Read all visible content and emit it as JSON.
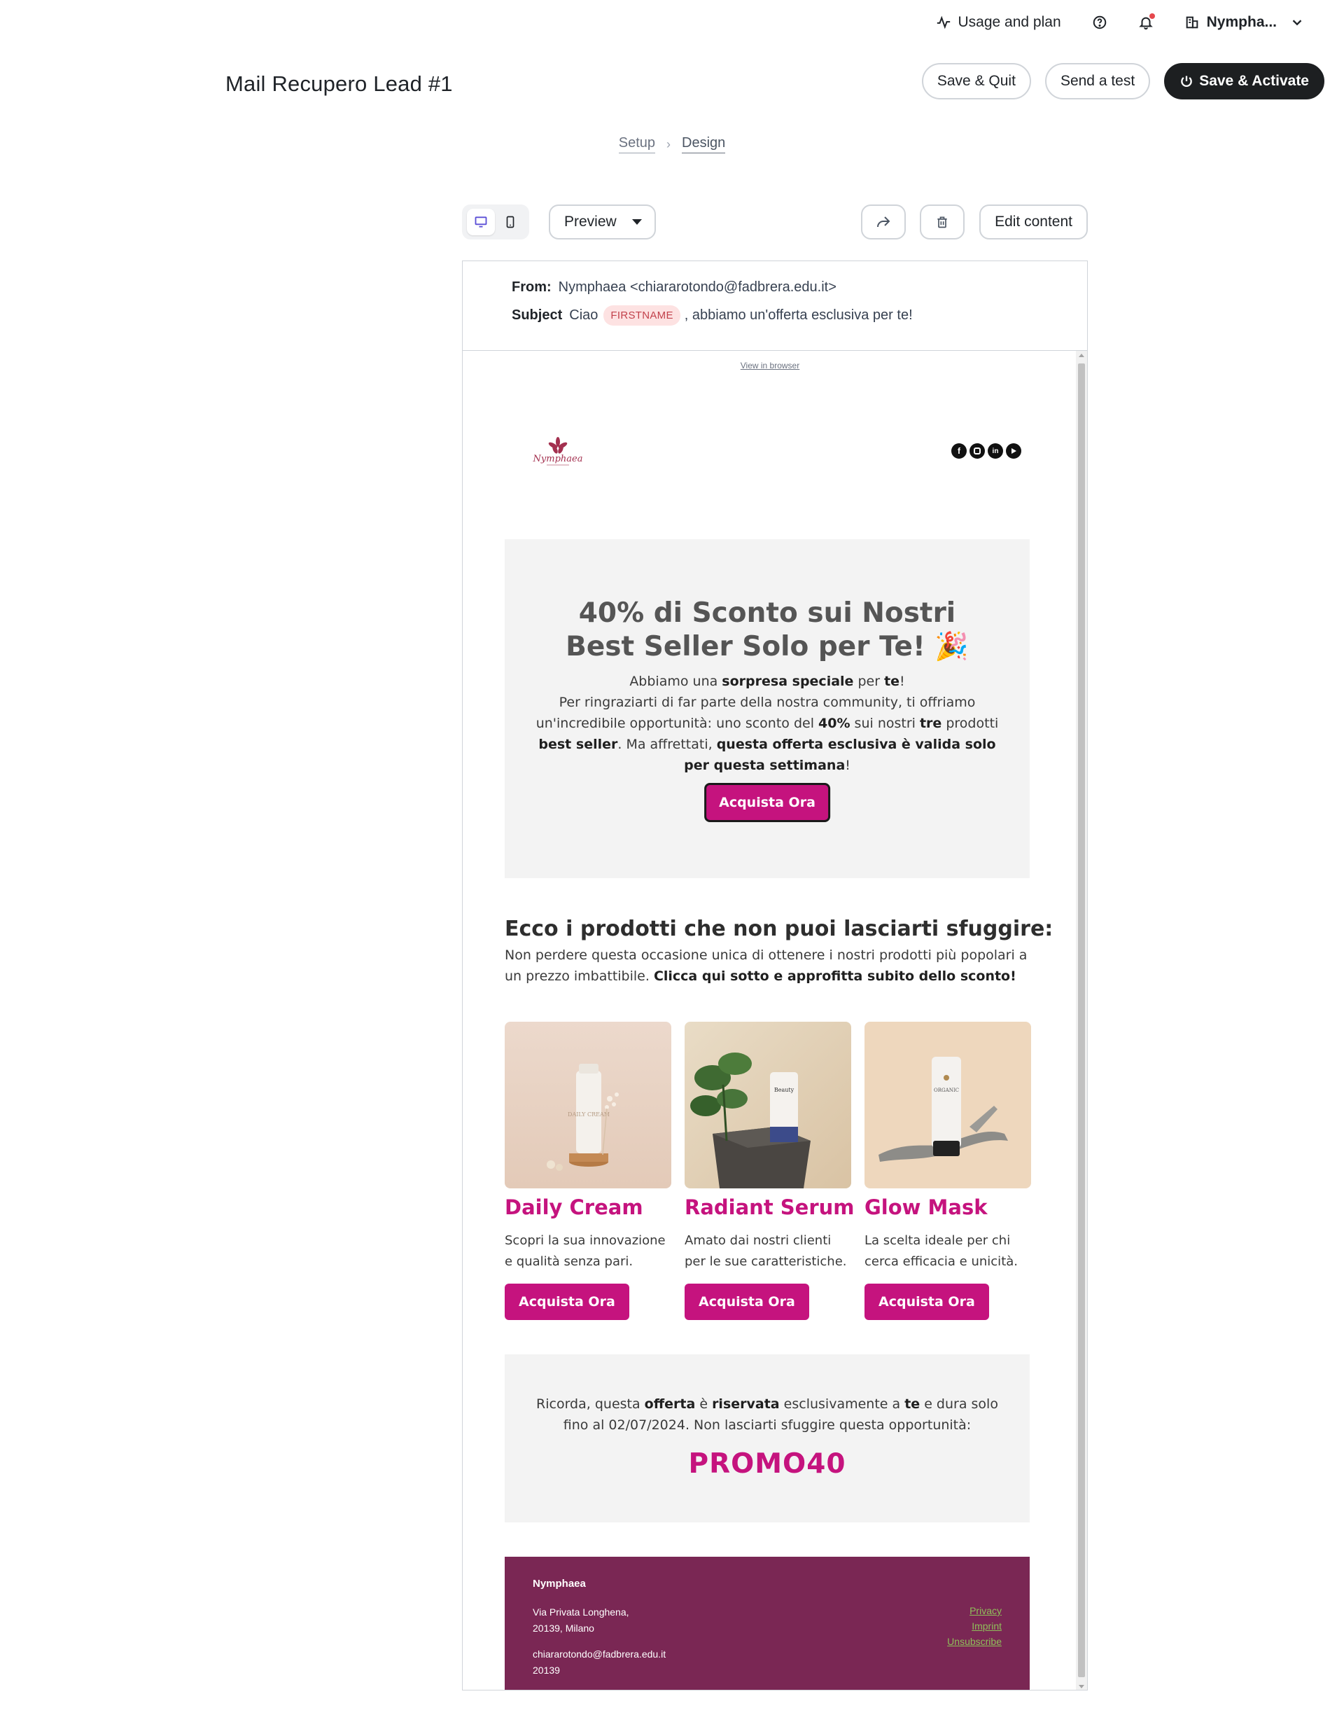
{
  "topbar": {
    "usage_label": "Usage and plan",
    "account_label": "Nympha..."
  },
  "header": {
    "title": "Mail Recupero Lead #1",
    "save_quit": "Save & Quit",
    "send_test": "Send a test",
    "save_activate": "Save & Activate"
  },
  "breadcrumb": {
    "setup": "Setup",
    "design": "Design"
  },
  "toolbar": {
    "preview_label": "Preview",
    "edit_label": "Edit content"
  },
  "meta": {
    "from_label": "From:",
    "from_value": "Nymphaea <chiararotondo@fadbrera.edu.it>",
    "subject_label": "Subject",
    "subject_pre": "Ciao",
    "subject_tag": "FIRSTNAME",
    "subject_post": ", abbiamo un'offerta esclusiva per te!"
  },
  "email": {
    "view_in_browser": "View in browser",
    "logo_text": "Nymphaea",
    "socials": [
      "facebook-icon",
      "instagram-icon",
      "linkedin-icon",
      "youtube-icon"
    ],
    "hero": {
      "title": "40% di Sconto sui Nostri Best Seller Solo per Te! 🎉",
      "p1_a": "Abbiamo una ",
      "p1_b": "sorpresa speciale",
      "p1_c": " per ",
      "p1_d": "te",
      "p1_e": "!",
      "p2_a": "Per ringraziarti di far parte della nostra community, ti offriamo un'incredibile opportunità: uno sconto del ",
      "p2_b": "40%",
      "p2_c": " sui nostri ",
      "p2_d": "tre",
      "p2_e": " prodotti ",
      "p2_f": "best seller",
      "p2_g": ". Ma affrettati, ",
      "p2_h": "questa offerta esclusiva è valida solo per questa settimana",
      "p2_i": "!",
      "cta": "Acquista Ora"
    },
    "section": {
      "title": "Ecco i prodotti che non puoi lasciarti sfuggire:",
      "text_a": "Non perdere questa occasione unica di ottenere i nostri prodotti più popolari a un prezzo imbattibile. ",
      "text_b": "Clicca qui sotto e approfitta subito dello sconto!"
    },
    "products": [
      {
        "name": "Daily Cream",
        "desc": "Scopri la sua innovazione e qualità senza pari.",
        "cta": "Acquista Ora",
        "tube_label": "DAILY CREAM"
      },
      {
        "name": "Radiant Serum",
        "desc": "Amato dai nostri clienti per le sue caratteristiche.",
        "cta": "Acquista Ora",
        "tube_label": "Beauty"
      },
      {
        "name": "Glow Mask",
        "desc": "La scelta ideale per chi cerca efficacia e unicità.",
        "cta": "Acquista Ora",
        "tube_label": "ORGANIC"
      }
    ],
    "promo": {
      "a": "Ricorda, questa ",
      "b": "offerta",
      "c": " è ",
      "d": "riservata",
      "e": " esclusivamente a ",
      "f": "te",
      "g": " e dura solo fino al 02/07/2024. Non lasciarti sfuggire questa opportunità:",
      "code": "PROMO40"
    },
    "footer": {
      "brand": "Nymphaea",
      "addr1": "Via Privata Longhena,",
      "addr2": "20139, Milano",
      "email": "chiararotondo@fadbrera.edu.it",
      "zip": "20139",
      "links": [
        "Privacy",
        "Imprint",
        "Unsubscribe"
      ]
    }
  },
  "colors": {
    "accent": "#c5137e",
    "footer_bg": "#7a2754",
    "dark_button": "#1d1f21"
  }
}
